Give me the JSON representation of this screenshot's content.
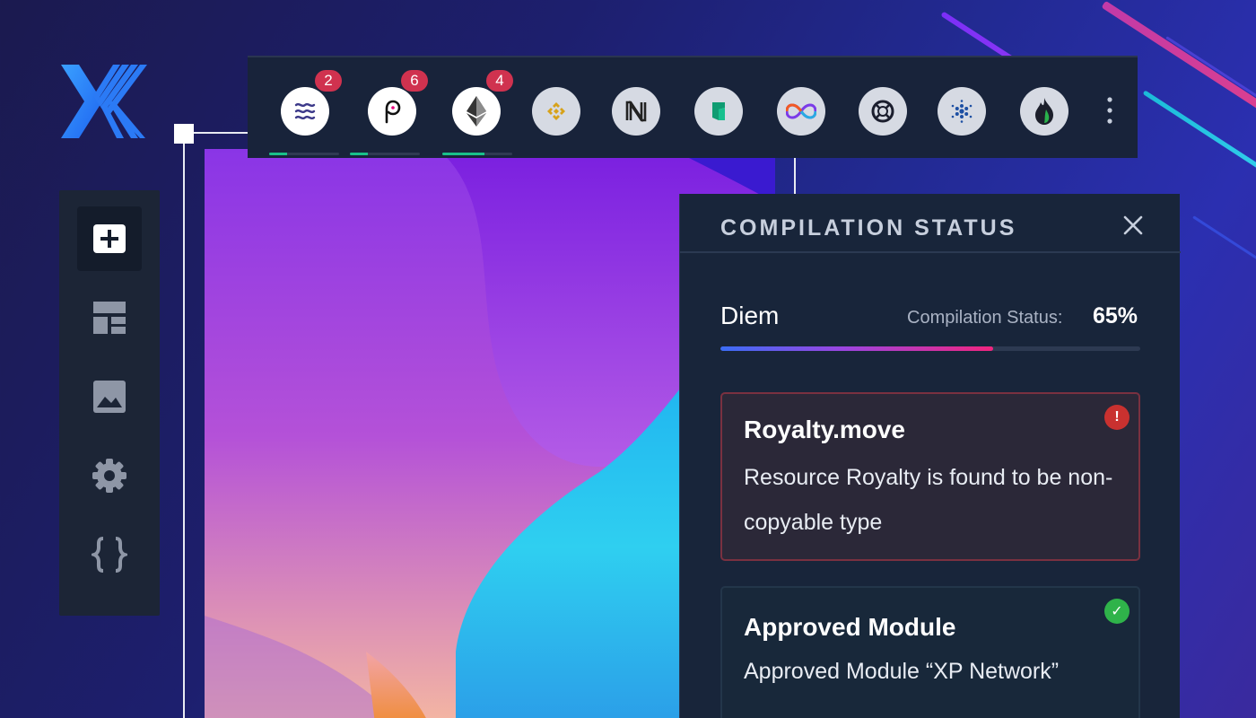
{
  "app": {
    "logo": "xp-network-logo"
  },
  "sidebar": {
    "items": [
      {
        "name": "add",
        "icon": "plus-icon",
        "active": true
      },
      {
        "name": "layout",
        "icon": "layout-icon",
        "active": false
      },
      {
        "name": "image",
        "icon": "image-icon",
        "active": false
      },
      {
        "name": "settings",
        "icon": "gear-icon",
        "active": false
      },
      {
        "name": "code",
        "icon": "braces-icon",
        "active": false
      }
    ]
  },
  "chains": [
    {
      "name": "diem",
      "icon": "diem-icon",
      "badge": "2",
      "progress": 0.25
    },
    {
      "name": "polkadot",
      "icon": "polkadot-icon",
      "badge": "6",
      "progress": 0.25
    },
    {
      "name": "ethereum",
      "icon": "ethereum-icon",
      "badge": "4",
      "progress": 0.6
    },
    {
      "name": "binance",
      "icon": "binance-icon"
    },
    {
      "name": "near",
      "icon": "near-icon"
    },
    {
      "name": "kadena",
      "icon": "kadena-icon"
    },
    {
      "name": "dfinity",
      "icon": "infinity-icon"
    },
    {
      "name": "elrond",
      "icon": "elrond-icon"
    },
    {
      "name": "cardano",
      "icon": "cardano-icon"
    },
    {
      "name": "heco",
      "icon": "flame-icon"
    }
  ],
  "panel": {
    "title": "COMPILATION STATUS",
    "chain_name": "Diem",
    "status_label": "Compilation Status:",
    "status_value": "65%",
    "progress": 0.65,
    "cards": [
      {
        "type": "error",
        "title": "Royalty.move",
        "body": "Resource Royalty is found to be non-copyable type",
        "status_glyph": "!"
      },
      {
        "type": "ok",
        "title": "Approved Module",
        "body": "Approved Module “XP Network”",
        "status_glyph": "✓"
      }
    ]
  },
  "colors": {
    "accent_blue": "#3b6df5",
    "accent_pink": "#f0257e",
    "error": "#c9312f",
    "success": "#2fb34a",
    "badge": "#d0324f",
    "chain_progress": "#19c08a"
  }
}
